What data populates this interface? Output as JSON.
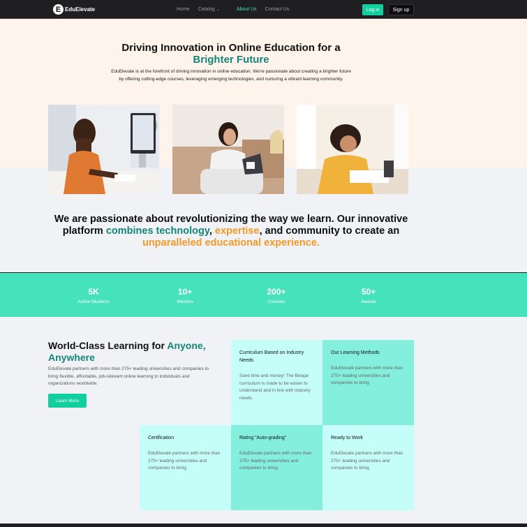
{
  "nav": {
    "logo_letter": "E",
    "logo_text": "EduElevate",
    "links": [
      "Home",
      "Catalog",
      "About Us",
      "Contact Us"
    ],
    "login": "Log in",
    "signup": "Sign up"
  },
  "hero": {
    "title_line1": "Driving Innovation in Online Education for a",
    "title_highlight": "Brighter Future",
    "description": "EduElevate is at the forefront of driving innovation in online education. We're passionate about creating a brighter future by offering cutting-edge courses, leveraging emerging technologies, and nurturing a vibrant learning community."
  },
  "mission": {
    "part1": "We are passionate about revolutionizing the way we learn. Our innovative platform ",
    "teal1": "combines technology",
    "sep1": ", ",
    "orange1": "expertise",
    "part2": ", and community to create an ",
    "orange2": "unparalleled educational experience."
  },
  "stats": [
    {
      "num": "5K",
      "label": "Active Students"
    },
    {
      "num": "10+",
      "label": "Mentors"
    },
    {
      "num": "200+",
      "label": "Courses"
    },
    {
      "num": "50+",
      "label": "Awards"
    }
  ],
  "learning": {
    "title_prefix": "World-Class Learning for ",
    "title_highlight": "Anyone, Anywhere",
    "description": "EduElevate partners with more than 275+ leading universities and companies to bring flexible, affordable, job-relevant online learning to individuals and organizations worldwide.",
    "button": "Learn More"
  },
  "cards": [
    {
      "title": "Curriculum Based on Industry Needs",
      "desc": "Save time and money! The Belajar curriculum is made to be easier to understand and in line with industry needs."
    },
    {
      "title": "Our Learning Methods",
      "desc": "EduElevate partners with more than 275+ leading universities and companies to bring"
    },
    {
      "title": "Certification",
      "desc": "EduElevate partners with more than 275+ leading universities and companies to bring"
    },
    {
      "title": "Rating \"Auto-grading\"",
      "desc": "EduElevate partners with more than 275+ leading universities and companies to bring"
    },
    {
      "title": "Ready to Work",
      "desc": "EduElevate partners with more than 275+ leading universities and companies to bring"
    }
  ],
  "colors": {
    "accent": "#12cfa0",
    "teal_text": "#14857a",
    "orange_text": "#f19a27",
    "stats_bg": "#46e2bc",
    "hero_bg": "#fff4eb",
    "nav_bg": "#1f1f21"
  }
}
